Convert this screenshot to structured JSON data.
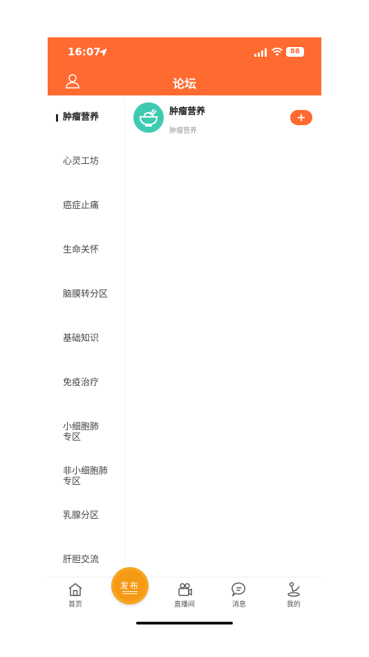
{
  "status": {
    "time": "16:07",
    "battery": "88"
  },
  "header": {
    "title": "论坛"
  },
  "sidebar": {
    "items": [
      {
        "label": "肿瘤营养"
      },
      {
        "label": "心灵工坊"
      },
      {
        "label": "癌症止痛"
      },
      {
        "label": "生命关怀"
      },
      {
        "label": "脑膜转分区"
      },
      {
        "label": "基础知识"
      },
      {
        "label": "免疫治疗"
      },
      {
        "label": "小细胞肺\n专区"
      },
      {
        "label": "非小细胞肺\n专区"
      },
      {
        "label": "乳腺分区"
      },
      {
        "label": "肝胆交流"
      }
    ]
  },
  "forum": {
    "title": "肿瘤营养",
    "subtitle": "肿瘤营养"
  },
  "tabbar": {
    "home": "首页",
    "publish": "发布",
    "live": "直播间",
    "messages": "消息",
    "mine": "我的"
  },
  "colors": {
    "brand": "#ff6a30",
    "publish": "#f6a622",
    "avatar": "#3fcbb1"
  }
}
